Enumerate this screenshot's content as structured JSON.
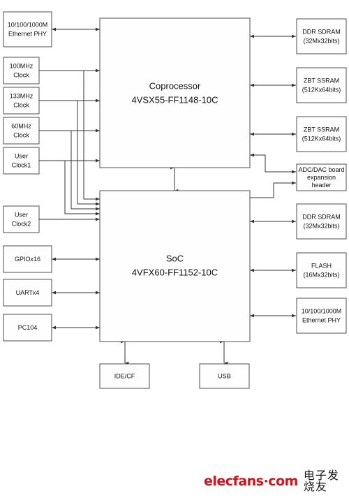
{
  "figure": {
    "type": "block-diagram",
    "background_color": "#ffffff",
    "block_fill": "#fefefe",
    "block_stroke": "#4d4d4d",
    "connector_color": "#333333"
  },
  "core_blocks": [
    {
      "id": "coprocessor",
      "line1": "Coprocessor",
      "line2": "4VSX55-FF1148-10C"
    },
    {
      "id": "soc",
      "line1": "SoC",
      "line2": "4VFX60-FF1152-10C"
    }
  ],
  "left_blocks": [
    {
      "id": "eth-phy-top",
      "line1": "10/100/1000M",
      "line2": "Ethernet PHY"
    },
    {
      "id": "clk-100mhz",
      "line1": "100MHz",
      "line2": "Clock"
    },
    {
      "id": "clk-133mhz",
      "line1": "133MHz",
      "line2": "Clock"
    },
    {
      "id": "clk-60mhz",
      "line1": "60MHz",
      "line2": "Clock"
    },
    {
      "id": "clk-user1",
      "line1": "User",
      "line2": "Clock1"
    },
    {
      "id": "clk-user2",
      "line1": "User",
      "line2": "Clock2"
    },
    {
      "id": "gpio",
      "line1": "GPIOx16",
      "line2": ""
    },
    {
      "id": "uart",
      "line1": "UARTx4",
      "line2": ""
    },
    {
      "id": "pc104",
      "line1": "PC104",
      "line2": ""
    }
  ],
  "right_blocks": [
    {
      "id": "ddr-sdram-top",
      "line1": "DDR SDRAM",
      "line2": "(32Mx32bits)"
    },
    {
      "id": "zbt-ssram-1",
      "line1": "ZBT SSRAM",
      "line2": "(512Kx64bits)"
    },
    {
      "id": "zbt-ssram-2",
      "line1": "ZBT SSRAM",
      "line2": "(512Kx64bits)"
    },
    {
      "id": "adc-dac-header",
      "line1": "ADC/DAC board",
      "line2": "expansion",
      "line3": "header"
    },
    {
      "id": "ddr-sdram-bottom",
      "line1": "DDR SDRAM",
      "line2": "(32Mx32bits)"
    },
    {
      "id": "flash",
      "line1": "FLASH",
      "line2": "(16Mx32bits)"
    },
    {
      "id": "eth-phy-bottom",
      "line1": "10/100/1000M",
      "line2": "Ethernet PHY"
    }
  ],
  "bottom_blocks": [
    {
      "id": "ide-cf",
      "line1": "IDE/CF"
    },
    {
      "id": "usb",
      "line1": "USB"
    }
  ],
  "watermark": {
    "latin": "elecfans·com",
    "chinese": "电子发烧友",
    "latin_color": "#d4121c",
    "chinese_color": "#1a1a1a"
  }
}
